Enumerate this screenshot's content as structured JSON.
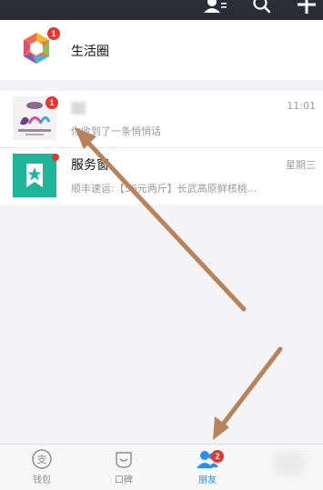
{
  "header": {
    "icons": [
      "contacts-icon",
      "search-icon",
      "add-icon"
    ]
  },
  "life_circle": {
    "title": "生活圈",
    "badge": "1",
    "icon": "life-circle-logo-icon"
  },
  "messages": [
    {
      "name": "",
      "name_blurred": true,
      "preview": "你收到了一条悄悄话",
      "time": "11:01",
      "badge": "1",
      "avatar": "group-photo-avatar"
    },
    {
      "name": "服务窗",
      "preview": "顺丰速运:【56元两斤】长武高原鲜核桃...",
      "time": "星期三",
      "has_dot": true,
      "avatar": "service-window-star-icon"
    }
  ],
  "tabbar": {
    "tabs": [
      {
        "label": "钱包",
        "icon": "wallet-icon",
        "active": false
      },
      {
        "label": "口碑",
        "icon": "koubei-icon",
        "active": false
      },
      {
        "label": "朋友",
        "icon": "friends-icon",
        "active": true,
        "badge": "2"
      },
      {
        "label": "",
        "icon": "mine-icon",
        "active": false,
        "blurred": true
      }
    ]
  },
  "colors": {
    "header_bg": "#2c2c36",
    "badge_red": "#e8362f",
    "active_blue": "#2a8ff0",
    "service_green": "#1fb59a",
    "arrow_brown": "#b8835a"
  },
  "annotations": {
    "arrows": [
      {
        "description": "points to first message row"
      },
      {
        "description": "points to friends tab"
      }
    ]
  }
}
